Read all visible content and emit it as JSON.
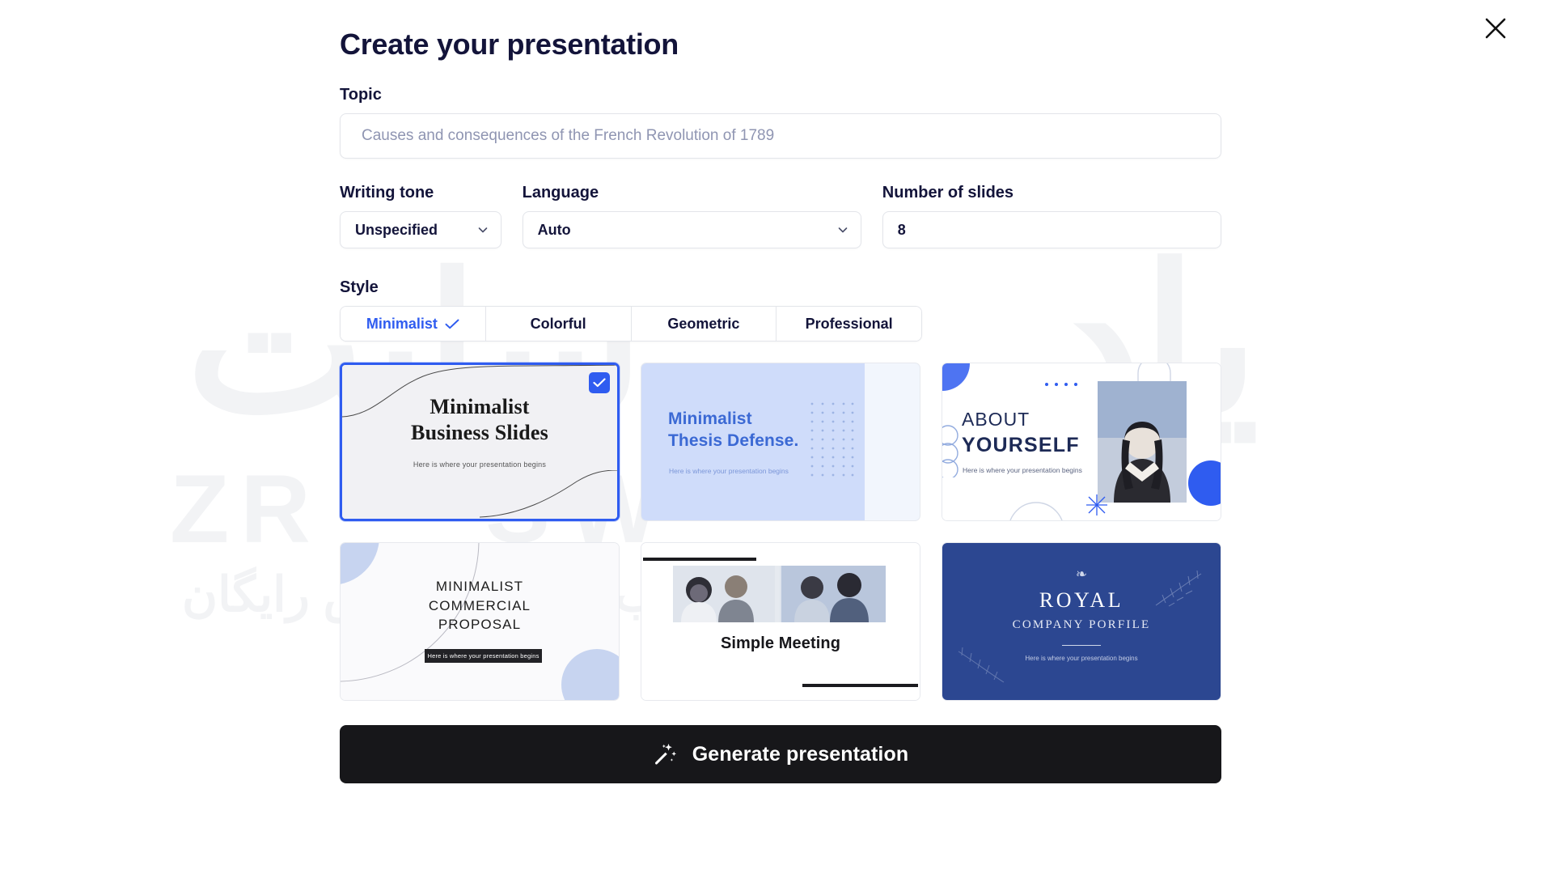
{
  "dialog": {
    "title": "Create your presentation",
    "close_label": "close-icon"
  },
  "topic": {
    "label": "Topic",
    "placeholder": "Causes and consequences of the French Revolution of 1789",
    "value": ""
  },
  "writing_tone": {
    "label": "Writing tone",
    "value": "Unspecified"
  },
  "language": {
    "label": "Language",
    "value": "Auto"
  },
  "number_of_slides": {
    "label": "Number of slides",
    "value": "8"
  },
  "style": {
    "label": "Style",
    "tabs": [
      {
        "label": "Minimalist",
        "selected": true
      },
      {
        "label": "Colorful",
        "selected": false
      },
      {
        "label": "Geometric",
        "selected": false
      },
      {
        "label": "Professional",
        "selected": false
      }
    ]
  },
  "templates": [
    {
      "id": "minimalist-business-slides",
      "title_line1": "Minimalist",
      "title_line2": "Business Slides",
      "subtitle": "Here is where your presentation begins",
      "selected": true
    },
    {
      "id": "minimalist-thesis-defense",
      "title_line1": "Minimalist",
      "title_line2": "Thesis Defense.",
      "subtitle": "Here is where your presentation begins",
      "selected": false
    },
    {
      "id": "about-yourself",
      "title_line1": "ABOUT",
      "title_line2": "YOURSELF",
      "subtitle": "Here is where your presentation begins",
      "selected": false
    },
    {
      "id": "minimalist-commercial-proposal",
      "title_line1": "MINIMALIST",
      "title_line2": "COMMERCIAL",
      "title_line3": "PROPOSAL",
      "subtitle": "Here is where your presentation begins",
      "selected": false
    },
    {
      "id": "simple-meeting",
      "title_line1": "Simple Meeting",
      "selected": false
    },
    {
      "id": "royal-company-porfile",
      "title_line1": "ROYAL",
      "title_line2": "COMPANY PORFILE",
      "subtitle": "Here is where your presentation begins",
      "selected": false
    }
  ],
  "generate": {
    "label": "Generate presentation",
    "icon": "magic-wand-icon"
  },
  "watermark": {
    "line1": "سایت",
    "line2": "یاد",
    "line3": "آموزش رایگان",
    "line4": "طراحی وب",
    "lat1": "ZR",
    "lat2": "SW"
  },
  "colors": {
    "accent": "#2f5cf0",
    "title": "#13143a",
    "button_bg": "#17171a",
    "border": "#e3e5ea"
  }
}
